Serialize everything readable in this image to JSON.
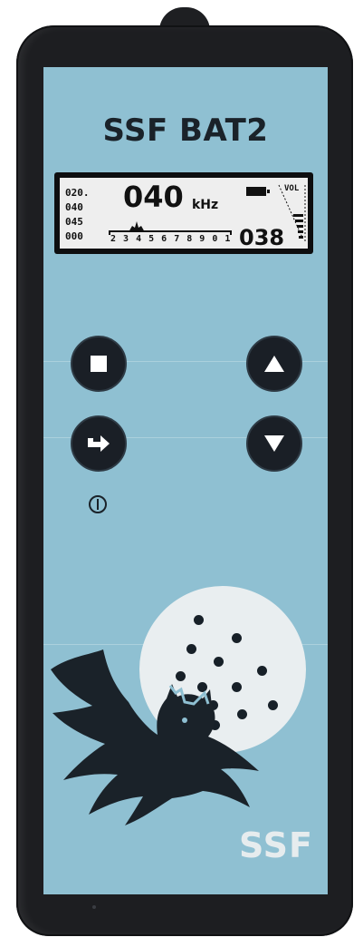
{
  "device": {
    "title": "SSF BAT2",
    "logo": "SSF"
  },
  "lcd": {
    "left_values": [
      "020.",
      "040",
      "045",
      "000"
    ],
    "frequency": "040",
    "unit": "kHz",
    "volume_label": "VOL",
    "scale": "2 3 4 5 6 7 8 9 0 1",
    "count": "038"
  },
  "buttons": {
    "stop": "stop-icon",
    "enter": "enter-arrow-icon",
    "up": "triangle-up-icon",
    "down": "triangle-down-icon",
    "power": "power-icon"
  },
  "colors": {
    "panel": "#8fc0d2",
    "housing": "#1d1e21",
    "moon": "#e9eef0",
    "lcd": "#eeeeee",
    "ink": "#1a2229"
  }
}
